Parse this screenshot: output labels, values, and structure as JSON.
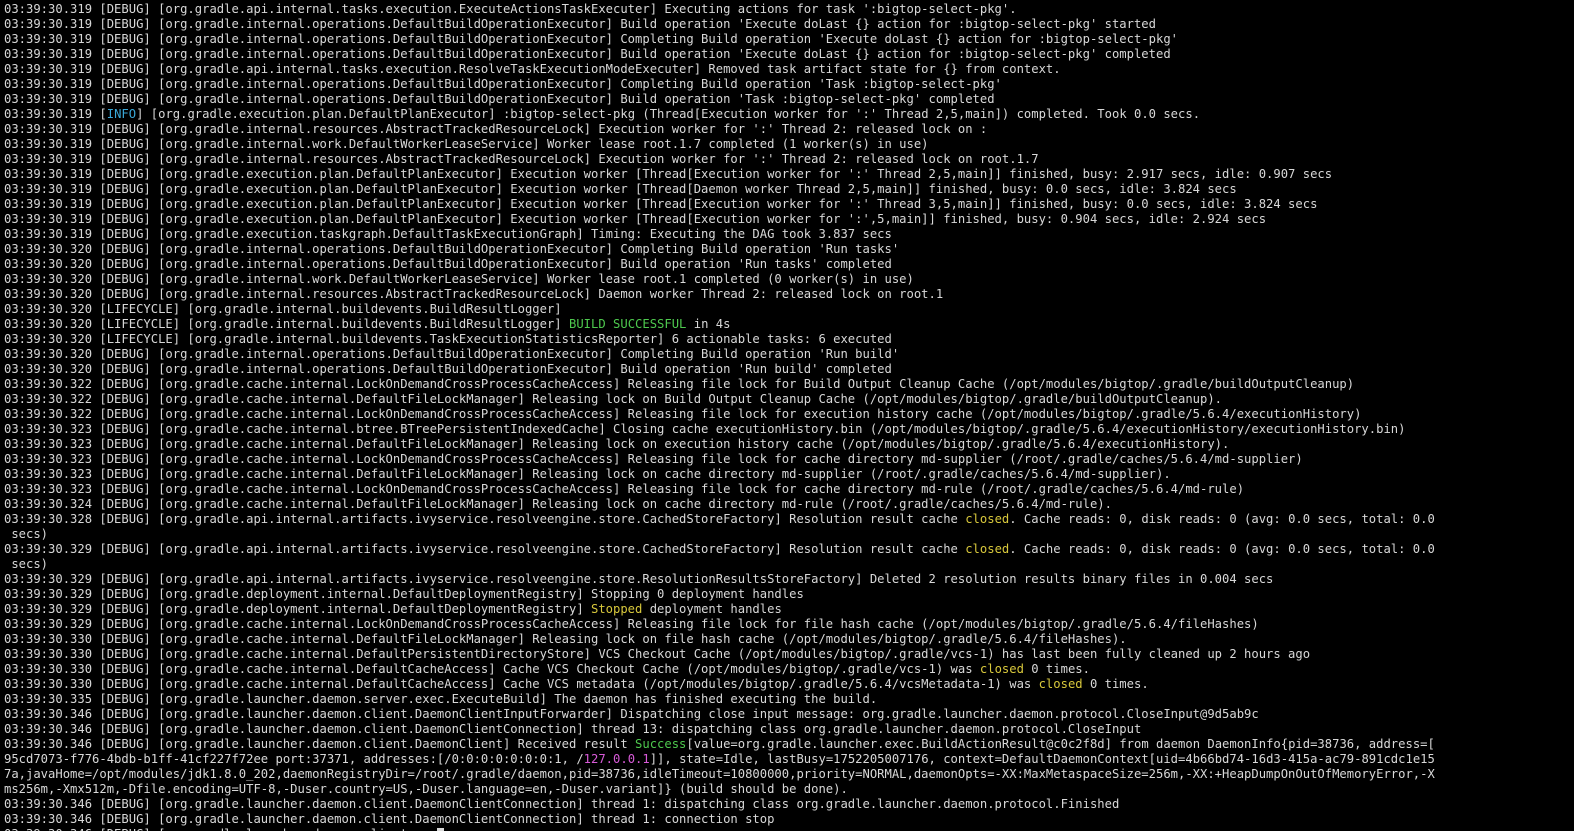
{
  "terminal": {
    "colors": {
      "background": "#000000",
      "text": "#d8d8d8",
      "info": "#3aa8d8",
      "green": "#4ec94e",
      "yellow": "#d8c83c",
      "magenta": "#d85ad8"
    },
    "lines": [
      {
        "segments": [
          {
            "t": "03:39:30.319 [DEBUG] [org.gradle.api.internal.tasks.execution.ExecuteActionsTaskExecuter] Executing actions for task ':bigtop-select-pkg'."
          }
        ]
      },
      {
        "segments": [
          {
            "t": "03:39:30.319 [DEBUG] [org.gradle.internal.operations.DefaultBuildOperationExecutor] Build operation 'Execute doLast {} action for :bigtop-select-pkg' started"
          }
        ]
      },
      {
        "segments": [
          {
            "t": "03:39:30.319 [DEBUG] [org.gradle.internal.operations.DefaultBuildOperationExecutor] Completing Build operation 'Execute doLast {} action for :bigtop-select-pkg'"
          }
        ]
      },
      {
        "segments": [
          {
            "t": "03:39:30.319 [DEBUG] [org.gradle.internal.operations.DefaultBuildOperationExecutor] Build operation 'Execute doLast {} action for :bigtop-select-pkg' completed"
          }
        ]
      },
      {
        "segments": [
          {
            "t": "03:39:30.319 [DEBUG] [org.gradle.api.internal.tasks.execution.ResolveTaskExecutionModeExecuter] Removed task artifact state for {} from context."
          }
        ]
      },
      {
        "segments": [
          {
            "t": "03:39:30.319 [DEBUG] [org.gradle.internal.operations.DefaultBuildOperationExecutor] Completing Build operation 'Task :bigtop-select-pkg'"
          }
        ]
      },
      {
        "segments": [
          {
            "t": "03:39:30.319 [DEBUG] [org.gradle.internal.operations.DefaultBuildOperationExecutor] Build operation 'Task :bigtop-select-pkg' completed"
          }
        ]
      },
      {
        "segments": [
          {
            "t": "03:39:30.319 ["
          },
          {
            "t": "INFO",
            "c": "info"
          },
          {
            "t": "] [org.gradle.execution.plan.DefaultPlanExecutor] :bigtop-select-pkg (Thread[Execution worker for ':' Thread 2,5,main]) completed. Took 0.0 secs."
          }
        ]
      },
      {
        "segments": [
          {
            "t": "03:39:30.319 [DEBUG] [org.gradle.internal.resources.AbstractTrackedResourceLock] Execution worker for ':' Thread 2: released lock on :"
          }
        ]
      },
      {
        "segments": [
          {
            "t": "03:39:30.319 [DEBUG] [org.gradle.internal.work.DefaultWorkerLeaseService] Worker lease root.1.7 completed (1 worker(s) in use)"
          }
        ]
      },
      {
        "segments": [
          {
            "t": "03:39:30.319 [DEBUG] [org.gradle.internal.resources.AbstractTrackedResourceLock] Execution worker for ':' Thread 2: released lock on root.1.7"
          }
        ]
      },
      {
        "segments": [
          {
            "t": "03:39:30.319 [DEBUG] [org.gradle.execution.plan.DefaultPlanExecutor] Execution worker [Thread[Execution worker for ':' Thread 2,5,main]] finished, busy: 2.917 secs, idle: 0.907 secs"
          }
        ]
      },
      {
        "segments": [
          {
            "t": "03:39:30.319 [DEBUG] [org.gradle.execution.plan.DefaultPlanExecutor] Execution worker [Thread[Daemon worker Thread 2,5,main]] finished, busy: 0.0 secs, idle: 3.824 secs"
          }
        ]
      },
      {
        "segments": [
          {
            "t": "03:39:30.319 [DEBUG] [org.gradle.execution.plan.DefaultPlanExecutor] Execution worker [Thread[Execution worker for ':' Thread 3,5,main]] finished, busy: 0.0 secs, idle: 3.824 secs"
          }
        ]
      },
      {
        "segments": [
          {
            "t": "03:39:30.319 [DEBUG] [org.gradle.execution.plan.DefaultPlanExecutor] Execution worker [Thread[Execution worker for ':',5,main]] finished, busy: 0.904 secs, idle: 2.924 secs"
          }
        ]
      },
      {
        "segments": [
          {
            "t": "03:39:30.319 [DEBUG] [org.gradle.execution.taskgraph.DefaultTaskExecutionGraph] Timing: Executing the DAG took 3.837 secs"
          }
        ]
      },
      {
        "segments": [
          {
            "t": "03:39:30.320 [DEBUG] [org.gradle.internal.operations.DefaultBuildOperationExecutor] Completing Build operation 'Run tasks'"
          }
        ]
      },
      {
        "segments": [
          {
            "t": "03:39:30.320 [DEBUG] [org.gradle.internal.operations.DefaultBuildOperationExecutor] Build operation 'Run tasks' completed"
          }
        ]
      },
      {
        "segments": [
          {
            "t": "03:39:30.320 [DEBUG] [org.gradle.internal.work.DefaultWorkerLeaseService] Worker lease root.1 completed (0 worker(s) in use)"
          }
        ]
      },
      {
        "segments": [
          {
            "t": "03:39:30.320 [DEBUG] [org.gradle.internal.resources.AbstractTrackedResourceLock] Daemon worker Thread 2: released lock on root.1"
          }
        ]
      },
      {
        "segments": [
          {
            "t": "03:39:30.320 [LIFECYCLE] [org.gradle.internal.buildevents.BuildResultLogger]"
          }
        ]
      },
      {
        "segments": [
          {
            "t": "03:39:30.320 [LIFECYCLE] [org.gradle.internal.buildevents.BuildResultLogger] "
          },
          {
            "t": "BUILD SUCCESSFUL",
            "c": "green"
          },
          {
            "t": " in 4s"
          }
        ]
      },
      {
        "segments": [
          {
            "t": "03:39:30.320 [LIFECYCLE] [org.gradle.internal.buildevents.TaskExecutionStatisticsReporter] 6 actionable tasks: 6 executed"
          }
        ]
      },
      {
        "segments": [
          {
            "t": "03:39:30.320 [DEBUG] [org.gradle.internal.operations.DefaultBuildOperationExecutor] Completing Build operation 'Run build'"
          }
        ]
      },
      {
        "segments": [
          {
            "t": "03:39:30.320 [DEBUG] [org.gradle.internal.operations.DefaultBuildOperationExecutor] Build operation 'Run build' completed"
          }
        ]
      },
      {
        "segments": [
          {
            "t": "03:39:30.322 [DEBUG] [org.gradle.cache.internal.LockOnDemandCrossProcessCacheAccess] Releasing file lock for Build Output Cleanup Cache (/opt/modules/bigtop/.gradle/buildOutputCleanup)"
          }
        ]
      },
      {
        "segments": [
          {
            "t": "03:39:30.322 [DEBUG] [org.gradle.cache.internal.DefaultFileLockManager] Releasing lock on Build Output Cleanup Cache (/opt/modules/bigtop/.gradle/buildOutputCleanup)."
          }
        ]
      },
      {
        "segments": [
          {
            "t": "03:39:30.322 [DEBUG] [org.gradle.cache.internal.LockOnDemandCrossProcessCacheAccess] Releasing file lock for execution history cache (/opt/modules/bigtop/.gradle/5.6.4/executionHistory)"
          }
        ]
      },
      {
        "segments": [
          {
            "t": "03:39:30.323 [DEBUG] [org.gradle.cache.internal.btree.BTreePersistentIndexedCache] Closing cache executionHistory.bin (/opt/modules/bigtop/.gradle/5.6.4/executionHistory/executionHistory.bin)"
          }
        ]
      },
      {
        "segments": [
          {
            "t": "03:39:30.323 [DEBUG] [org.gradle.cache.internal.DefaultFileLockManager] Releasing lock on execution history cache (/opt/modules/bigtop/.gradle/5.6.4/executionHistory)."
          }
        ]
      },
      {
        "segments": [
          {
            "t": "03:39:30.323 [DEBUG] [org.gradle.cache.internal.LockOnDemandCrossProcessCacheAccess] Releasing file lock for cache directory md-supplier (/root/.gradle/caches/5.6.4/md-supplier)"
          }
        ]
      },
      {
        "segments": [
          {
            "t": "03:39:30.323 [DEBUG] [org.gradle.cache.internal.DefaultFileLockManager] Releasing lock on cache directory md-supplier (/root/.gradle/caches/5.6.4/md-supplier)."
          }
        ]
      },
      {
        "segments": [
          {
            "t": "03:39:30.323 [DEBUG] [org.gradle.cache.internal.LockOnDemandCrossProcessCacheAccess] Releasing file lock for cache directory md-rule (/root/.gradle/caches/5.6.4/md-rule)"
          }
        ]
      },
      {
        "segments": [
          {
            "t": "03:39:30.324 [DEBUG] [org.gradle.cache.internal.DefaultFileLockManager] Releasing lock on cache directory md-rule (/root/.gradle/caches/5.6.4/md-rule)."
          }
        ]
      },
      {
        "segments": [
          {
            "t": "03:39:30.328 [DEBUG] [org.gradle.api.internal.artifacts.ivyservice.resolveengine.store.CachedStoreFactory] Resolution result cache "
          },
          {
            "t": "closed",
            "c": "yellow"
          },
          {
            "t": ". Cache reads: 0, disk reads: 0 (avg: 0.0 secs, total: 0.0"
          }
        ]
      },
      {
        "segments": [
          {
            "t": " secs)"
          }
        ]
      },
      {
        "segments": [
          {
            "t": "03:39:30.329 [DEBUG] [org.gradle.api.internal.artifacts.ivyservice.resolveengine.store.CachedStoreFactory] Resolution result cache "
          },
          {
            "t": "closed",
            "c": "yellow"
          },
          {
            "t": ". Cache reads: 0, disk reads: 0 (avg: 0.0 secs, total: 0.0"
          }
        ]
      },
      {
        "segments": [
          {
            "t": " secs)"
          }
        ]
      },
      {
        "segments": [
          {
            "t": "03:39:30.329 [DEBUG] [org.gradle.api.internal.artifacts.ivyservice.resolveengine.store.ResolutionResultsStoreFactory] Deleted 2 resolution results binary files in 0.004 secs"
          }
        ]
      },
      {
        "segments": [
          {
            "t": "03:39:30.329 [DEBUG] [org.gradle.deployment.internal.DefaultDeploymentRegistry] Stopping 0 deployment handles"
          }
        ]
      },
      {
        "segments": [
          {
            "t": "03:39:30.329 [DEBUG] [org.gradle.deployment.internal.DefaultDeploymentRegistry] "
          },
          {
            "t": "Stopped",
            "c": "yellow"
          },
          {
            "t": " deployment handles"
          }
        ]
      },
      {
        "segments": [
          {
            "t": "03:39:30.329 [DEBUG] [org.gradle.cache.internal.LockOnDemandCrossProcessCacheAccess] Releasing file lock for file hash cache (/opt/modules/bigtop/.gradle/5.6.4/fileHashes)"
          }
        ]
      },
      {
        "segments": [
          {
            "t": "03:39:30.330 [DEBUG] [org.gradle.cache.internal.DefaultFileLockManager] Releasing lock on file hash cache (/opt/modules/bigtop/.gradle/5.6.4/fileHashes)."
          }
        ]
      },
      {
        "segments": [
          {
            "t": "03:39:30.330 [DEBUG] [org.gradle.cache.internal.DefaultPersistentDirectoryStore] VCS Checkout Cache (/opt/modules/bigtop/.gradle/vcs-1) has last been fully cleaned up 2 hours ago"
          }
        ]
      },
      {
        "segments": [
          {
            "t": "03:39:30.330 [DEBUG] [org.gradle.cache.internal.DefaultCacheAccess] Cache VCS Checkout Cache (/opt/modules/bigtop/.gradle/vcs-1) was "
          },
          {
            "t": "closed",
            "c": "yellow"
          },
          {
            "t": " 0 times."
          }
        ]
      },
      {
        "segments": [
          {
            "t": "03:39:30.330 [DEBUG] [org.gradle.cache.internal.DefaultCacheAccess] Cache VCS metadata (/opt/modules/bigtop/.gradle/5.6.4/vcsMetadata-1) was "
          },
          {
            "t": "closed",
            "c": "yellow"
          },
          {
            "t": " 0 times."
          }
        ]
      },
      {
        "segments": [
          {
            "t": "03:39:30.335 [DEBUG] [org.gradle.launcher.daemon.server.exec.ExecuteBuild] The daemon has finished executing the build."
          }
        ]
      },
      {
        "segments": [
          {
            "t": "03:39:30.346 [DEBUG] [org.gradle.launcher.daemon.client.DaemonClientInputForwarder] Dispatching close input message: org.gradle.launcher.daemon.protocol.CloseInput@9d5ab9c"
          }
        ]
      },
      {
        "segments": [
          {
            "t": "03:39:30.346 [DEBUG] [org.gradle.launcher.daemon.client.DaemonClientConnection] thread 13: dispatching class org.gradle.launcher.daemon.protocol.CloseInput"
          }
        ]
      },
      {
        "segments": [
          {
            "t": "03:39:30.346 [DEBUG] [org.gradle.launcher.daemon.client.DaemonClient] Received result "
          },
          {
            "t": "Success",
            "c": "green"
          },
          {
            "t": "[value=org.gradle.launcher.exec.BuildActionResult@c0c2f8d] from daemon DaemonInfo{pid=38736, address=["
          }
        ]
      },
      {
        "segments": [
          {
            "t": "95cd7073-f776-4bdb-b1ff-41cf227f72ee port:37371, addresses:[/0:0:0:0:0:0:0:1, /"
          },
          {
            "t": "127.0.0.1",
            "c": "magenta"
          },
          {
            "t": "]], state=Idle, lastBusy=1752205007176, context=DefaultDaemonContext[uid=4b66bd74-16d3-415a-ac79-891cdc1e15"
          }
        ]
      },
      {
        "segments": [
          {
            "t": "7a,javaHome=/opt/modules/jdk1.8.0_202,daemonRegistryDir=/root/.gradle/daemon,pid=38736,idleTimeout=10800000,priority=NORMAL,daemonOpts=-XX:MaxMetaspaceSize=256m,-XX:+HeapDumpOnOutOfMemoryError,-X"
          }
        ]
      },
      {
        "segments": [
          {
            "t": "ms256m,-Xmx512m,-Dfile.encoding=UTF-8,-Duser.country=US,-Duser.language=en,-Duser.variant]} (build should be done)."
          }
        ]
      },
      {
        "segments": [
          {
            "t": "03:39:30.346 [DEBUG] [org.gradle.launcher.daemon.client.DaemonClientConnection] thread 1: dispatching class org.gradle.launcher.daemon.protocol.Finished"
          }
        ]
      },
      {
        "segments": [
          {
            "t": "03:39:30.346 [DEBUG] [org.gradle.launcher.daemon.client.DaemonClientConnection] thread 1: connection stop"
          }
        ]
      },
      {
        "segments": [
          {
            "t": "03:39:30.346 [DEBUG] [org.gradle.launcher.daemon.client...."
          }
        ],
        "cursor": true
      }
    ]
  }
}
